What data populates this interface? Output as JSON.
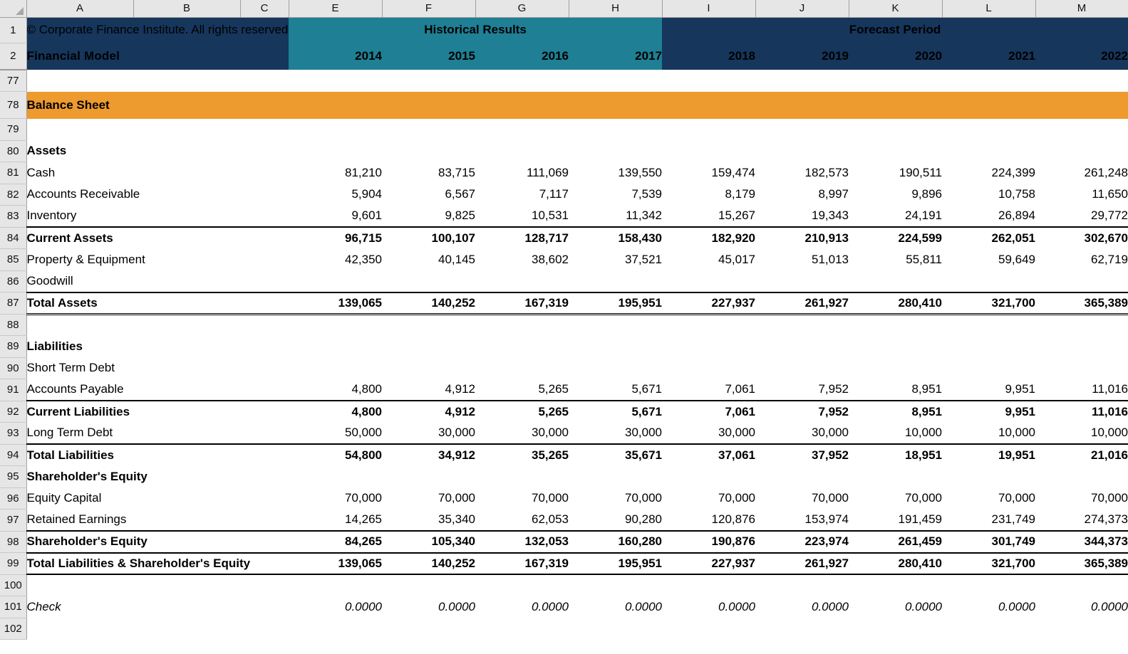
{
  "app": {
    "type": "spreadsheet",
    "corner_icon": "select-all-triangle-icon"
  },
  "columns": {
    "letters": [
      "A",
      "B",
      "C",
      "E",
      "F",
      "G",
      "H",
      "I",
      "J",
      "K",
      "L",
      "M"
    ],
    "hidden_after": "C"
  },
  "row_numbers": [
    "1",
    "2",
    "77",
    "78",
    "79",
    "80",
    "81",
    "82",
    "83",
    "84",
    "85",
    "86",
    "87",
    "88",
    "89",
    "90",
    "91",
    "92",
    "93",
    "94",
    "95",
    "96",
    "97",
    "98",
    "99",
    "100",
    "101",
    "102"
  ],
  "header": {
    "copyright": "© Corporate Finance Institute. All rights reserved.",
    "title": "Financial Model",
    "historical_label": "Historical Results",
    "forecast_label": "Forecast Period",
    "historical_years": [
      "2014",
      "2015",
      "2016",
      "2017"
    ],
    "forecast_years": [
      "2018",
      "2019",
      "2020",
      "2021",
      "2022"
    ]
  },
  "section": {
    "title": "Balance Sheet"
  },
  "colors": {
    "navy": "#16365C",
    "teal": "#1F7F94",
    "orange": "#ED9A2F",
    "header_grey": "#E6E6E6",
    "text": "#000000"
  },
  "groups": {
    "assets": "Assets",
    "liabilities": "Liabilities",
    "equity": "Shareholder's Equity"
  },
  "rows": {
    "cash": {
      "label": "Cash",
      "values": [
        "81,210",
        "83,715",
        "111,069",
        "139,550",
        "159,474",
        "182,573",
        "190,511",
        "224,399",
        "261,248"
      ]
    },
    "ar": {
      "label": "Accounts Receivable",
      "values": [
        "5,904",
        "6,567",
        "7,117",
        "7,539",
        "8,179",
        "8,997",
        "9,896",
        "10,758",
        "11,650"
      ]
    },
    "inventory": {
      "label": "Inventory",
      "values": [
        "9,601",
        "9,825",
        "10,531",
        "11,342",
        "15,267",
        "19,343",
        "24,191",
        "26,894",
        "29,772"
      ]
    },
    "current_assets": {
      "label": "Current Assets",
      "values": [
        "96,715",
        "100,107",
        "128,717",
        "158,430",
        "182,920",
        "210,913",
        "224,599",
        "262,051",
        "302,670"
      ]
    },
    "ppe": {
      "label": "Property & Equipment",
      "values": [
        "42,350",
        "40,145",
        "38,602",
        "37,521",
        "45,017",
        "51,013",
        "55,811",
        "59,649",
        "62,719"
      ]
    },
    "goodwill": {
      "label": "Goodwill",
      "values": [
        "",
        "",
        "",
        "",
        "",
        "",
        "",
        "",
        ""
      ]
    },
    "total_assets": {
      "label": "Total Assets",
      "values": [
        "139,065",
        "140,252",
        "167,319",
        "195,951",
        "227,937",
        "261,927",
        "280,410",
        "321,700",
        "365,389"
      ]
    },
    "short_term_debt": {
      "label": "Short Term Debt",
      "values": [
        "",
        "",
        "",
        "",
        "",
        "",
        "",
        "",
        ""
      ]
    },
    "ap": {
      "label": "Accounts Payable",
      "values": [
        "4,800",
        "4,912",
        "5,265",
        "5,671",
        "7,061",
        "7,952",
        "8,951",
        "9,951",
        "11,016"
      ]
    },
    "current_liab": {
      "label": "Current Liabilities",
      "values": [
        "4,800",
        "4,912",
        "5,265",
        "5,671",
        "7,061",
        "7,952",
        "8,951",
        "9,951",
        "11,016"
      ]
    },
    "long_term_debt": {
      "label": "Long Term Debt",
      "values": [
        "50,000",
        "30,000",
        "30,000",
        "30,000",
        "30,000",
        "30,000",
        "10,000",
        "10,000",
        "10,000"
      ]
    },
    "total_liab": {
      "label": "Total Liabilities",
      "values": [
        "54,800",
        "34,912",
        "35,265",
        "35,671",
        "37,061",
        "37,952",
        "18,951",
        "19,951",
        "21,016"
      ]
    },
    "equity_capital": {
      "label": "Equity Capital",
      "values": [
        "70,000",
        "70,000",
        "70,000",
        "70,000",
        "70,000",
        "70,000",
        "70,000",
        "70,000",
        "70,000"
      ]
    },
    "retained": {
      "label": "Retained Earnings",
      "values": [
        "14,265",
        "35,340",
        "62,053",
        "90,280",
        "120,876",
        "153,974",
        "191,459",
        "231,749",
        "274,373"
      ]
    },
    "sh_equity": {
      "label": "Shareholder's Equity",
      "values": [
        "84,265",
        "105,340",
        "132,053",
        "160,280",
        "190,876",
        "223,974",
        "261,459",
        "301,749",
        "344,373"
      ]
    },
    "total_le": {
      "label": "Total Liabilities & Shareholder's Equity",
      "values": [
        "139,065",
        "140,252",
        "167,319",
        "195,951",
        "227,937",
        "261,927",
        "280,410",
        "321,700",
        "365,389"
      ]
    },
    "check": {
      "label": "Check",
      "values": [
        "0.0000",
        "0.0000",
        "0.0000",
        "0.0000",
        "0.0000",
        "0.0000",
        "0.0000",
        "0.0000",
        "0.0000"
      ]
    }
  }
}
